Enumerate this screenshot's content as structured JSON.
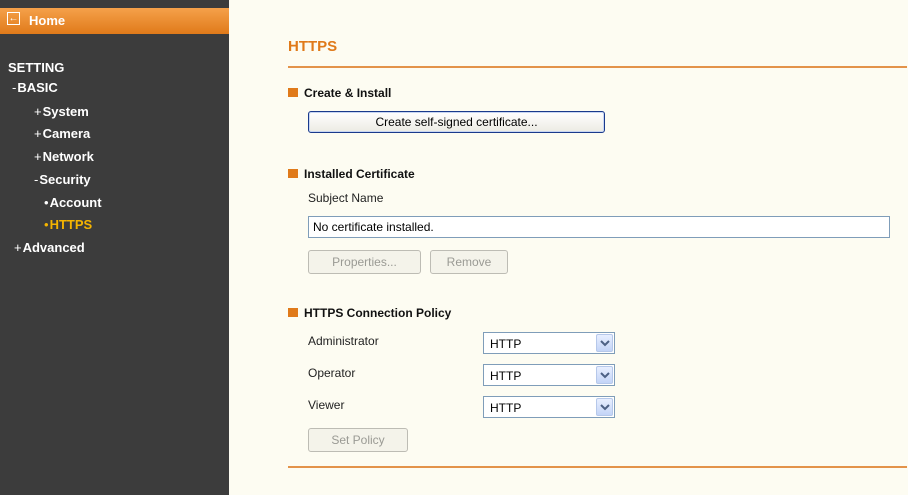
{
  "sidebar": {
    "home_label": "Home",
    "setting_label": "SETTING",
    "basic_label": "BASIC",
    "system_label": "System",
    "camera_label": "Camera",
    "network_label": "Network",
    "security_label": "Security",
    "account_label": "Account",
    "https_label": "HTTPS",
    "advanced_label": "Advanced",
    "active_item": "HTTPS",
    "colors": {
      "background": "#3c3c3c",
      "home_bar": "#e98a2c",
      "active": "#f5b400"
    }
  },
  "main": {
    "title": "HTTPS",
    "create_install": {
      "heading": "Create & Install",
      "create_button_label": "Create self-signed certificate..."
    },
    "installed_certificate": {
      "heading": "Installed Certificate",
      "subject_name_label": "Subject Name",
      "subject_name_value": "No certificate installed.",
      "properties_button_label": "Properties...",
      "remove_button_label": "Remove"
    },
    "connection_policy": {
      "heading": "HTTPS Connection Policy",
      "administrator_label": "Administrator",
      "administrator_value": "HTTP",
      "operator_label": "Operator",
      "operator_value": "HTTP",
      "viewer_label": "Viewer",
      "viewer_value": "HTTP",
      "set_policy_button_label": "Set Policy"
    },
    "colors": {
      "accent": "#e07a1a",
      "background": "#fdfcf2"
    }
  }
}
